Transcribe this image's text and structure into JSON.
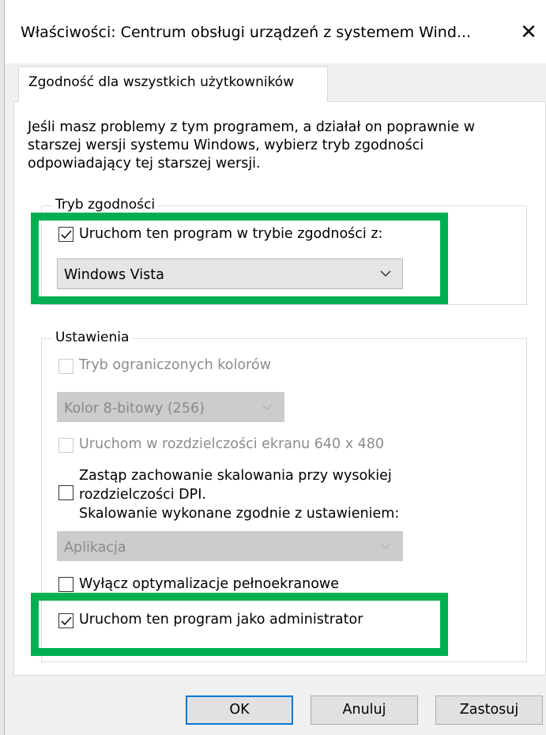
{
  "window": {
    "title": "Właściwości: Centrum obsługi urządzeń z systemem Wind...",
    "close_icon": "close-icon"
  },
  "tab": {
    "label": "Zgodność dla wszystkich użytkowników"
  },
  "description": "Jeśli masz problemy z tym programem, a działał on poprawnie w starszej wersji systemu Windows, wybierz tryb zgodności odpowiadający tej starszej wersji.",
  "compat_mode": {
    "group_label": "Tryb zgodności",
    "checkbox_label": "Uruchom ten program w trybie zgodności z:",
    "checked": true,
    "selected_os": "Windows Vista"
  },
  "settings": {
    "group_label": "Ustawienia",
    "reduced_color": {
      "label": "Tryb ograniczonych kolorów",
      "checked": false,
      "enabled": false,
      "selected_value": "Kolor 8-bitowy (256)"
    },
    "res_640": {
      "label": "Uruchom w rozdzielczości ekranu 640 x 480",
      "checked": false,
      "enabled": false
    },
    "dpi_override": {
      "label_line1": "Zastąp zachowanie skalowania przy wysokiej",
      "label_line2": "rozdzielczości DPI.",
      "label_line3": "Skalowanie wykonane zgodnie z ustawieniem:",
      "checked": false,
      "selected_value": "Aplikacja"
    },
    "fullscreen_opt": {
      "label": "Wyłącz optymalizacje pełnoekranowe",
      "checked": false
    },
    "run_as_admin": {
      "label": "Uruchom ten program jako administrator",
      "checked": true
    }
  },
  "buttons": {
    "ok": "OK",
    "cancel": "Anuluj",
    "apply": "Zastosuj"
  },
  "colors": {
    "highlight": "#00b050",
    "primary_button_border": "#0078d7"
  }
}
